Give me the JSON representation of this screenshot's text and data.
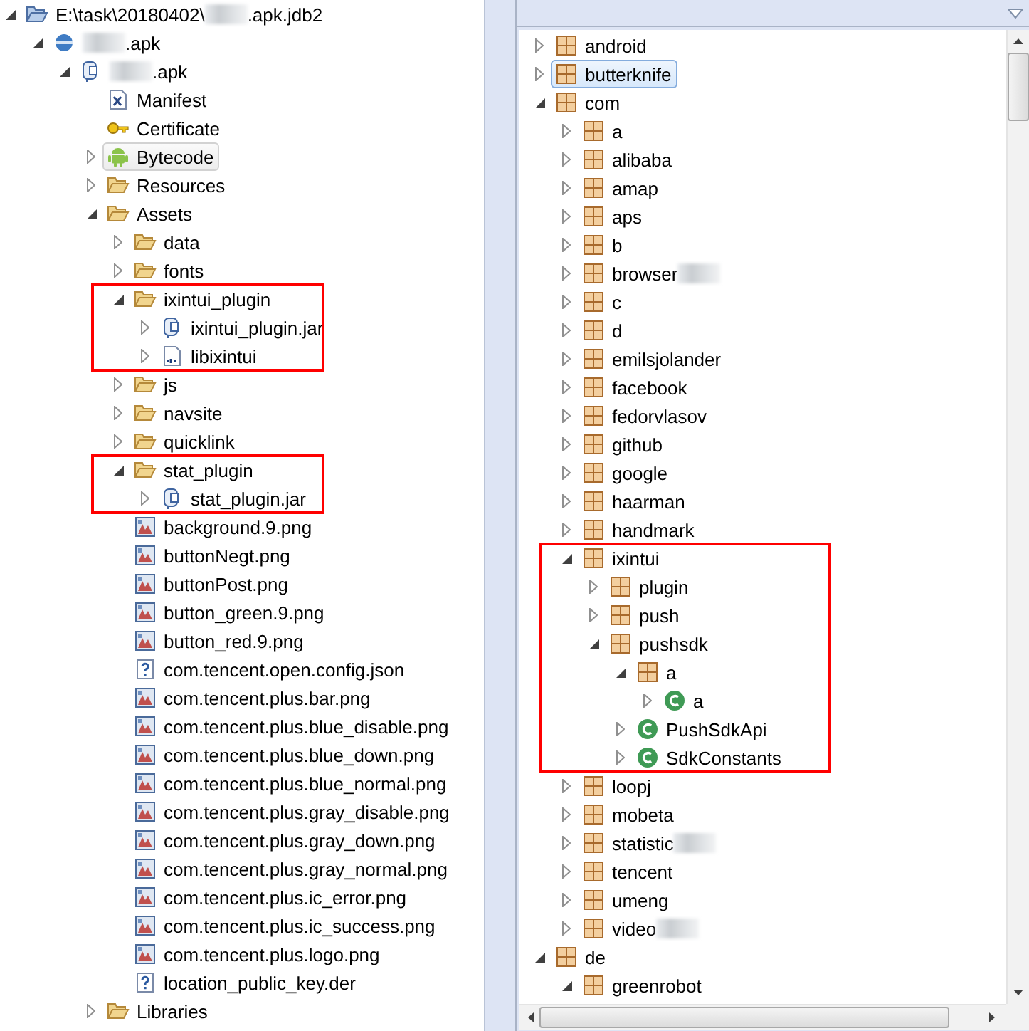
{
  "project_tree": [
    {
      "parts": [
        {
          "text": "E:\\task\\20180402\\"
        },
        {
          "kind": "blur"
        },
        {
          "text": ".apk.jdb2"
        }
      ],
      "kind": "project",
      "expanded": true,
      "selected": false,
      "children": [
        {
          "parts": [
            {
              "kind": "blur"
            },
            {
              "text": ".apk"
            }
          ],
          "kind": "sphere",
          "expanded": true,
          "selected": false,
          "children": [
            {
              "parts": [
                {
                  "kind": "blur"
                },
                {
                  "text": ".apk"
                }
              ],
              "kind": "archive",
              "expanded": true,
              "selected": false,
              "children": [
                {
                  "label": "Manifest",
                  "kind": "xml",
                  "selected": false
                },
                {
                  "label": "Certificate",
                  "kind": "key",
                  "selected": false
                },
                {
                  "label": "Bytecode",
                  "kind": "android",
                  "expanded": false,
                  "selected": true
                },
                {
                  "label": "Resources",
                  "kind": "folder",
                  "expanded": false,
                  "selected": false
                },
                {
                  "label": "Assets",
                  "kind": "folder",
                  "expanded": true,
                  "selected": false,
                  "children": [
                    {
                      "label": "data",
                      "kind": "folder",
                      "expanded": false,
                      "selected": false
                    },
                    {
                      "label": "fonts",
                      "kind": "folder",
                      "expanded": false,
                      "selected": false
                    },
                    {
                      "label": "ixintui_plugin",
                      "kind": "folder",
                      "expanded": true,
                      "selected": false,
                      "highlight": true,
                      "children": [
                        {
                          "label": "ixintui_plugin.jar",
                          "kind": "archive",
                          "expanded": false,
                          "selected": false
                        },
                        {
                          "label": "libixintui",
                          "kind": "binary",
                          "expanded": false,
                          "selected": false
                        }
                      ]
                    },
                    {
                      "label": "js",
                      "kind": "folder",
                      "expanded": false,
                      "selected": false
                    },
                    {
                      "label": "navsite",
                      "kind": "folder",
                      "expanded": false,
                      "selected": false
                    },
                    {
                      "label": "quicklink",
                      "kind": "folder",
                      "expanded": false,
                      "selected": false
                    },
                    {
                      "label": "stat_plugin",
                      "kind": "folder",
                      "expanded": true,
                      "selected": false,
                      "highlight": true,
                      "children": [
                        {
                          "label": "stat_plugin.jar",
                          "kind": "archive",
                          "expanded": false,
                          "selected": false
                        }
                      ]
                    },
                    {
                      "label": "background.9.png",
                      "kind": "image",
                      "selected": false
                    },
                    {
                      "label": "buttonNegt.png",
                      "kind": "image",
                      "selected": false
                    },
                    {
                      "label": "buttonPost.png",
                      "kind": "image",
                      "selected": false
                    },
                    {
                      "label": "button_green.9.png",
                      "kind": "image",
                      "selected": false
                    },
                    {
                      "label": "button_red.9.png",
                      "kind": "image",
                      "selected": false
                    },
                    {
                      "label": "com.tencent.open.config.json",
                      "kind": "unknown",
                      "selected": false
                    },
                    {
                      "label": "com.tencent.plus.bar.png",
                      "kind": "image",
                      "selected": false
                    },
                    {
                      "label": "com.tencent.plus.blue_disable.png",
                      "kind": "image",
                      "selected": false
                    },
                    {
                      "label": "com.tencent.plus.blue_down.png",
                      "kind": "image",
                      "selected": false
                    },
                    {
                      "label": "com.tencent.plus.blue_normal.png",
                      "kind": "image",
                      "selected": false
                    },
                    {
                      "label": "com.tencent.plus.gray_disable.png",
                      "kind": "image",
                      "selected": false
                    },
                    {
                      "label": "com.tencent.plus.gray_down.png",
                      "kind": "image",
                      "selected": false
                    },
                    {
                      "label": "com.tencent.plus.gray_normal.png",
                      "kind": "image",
                      "selected": false
                    },
                    {
                      "label": "com.tencent.plus.ic_error.png",
                      "kind": "image",
                      "selected": false
                    },
                    {
                      "label": "com.tencent.plus.ic_success.png",
                      "kind": "image",
                      "selected": false
                    },
                    {
                      "label": "com.tencent.plus.logo.png",
                      "kind": "image",
                      "selected": false
                    },
                    {
                      "label": "location_public_key.der",
                      "kind": "unknown",
                      "selected": false
                    }
                  ]
                },
                {
                  "label": "Libraries",
                  "kind": "folder",
                  "expanded": false,
                  "selected": false
                }
              ]
            }
          ]
        }
      ]
    }
  ],
  "package_tree": [
    {
      "label": "android",
      "kind": "package",
      "expanded": false,
      "selected": false
    },
    {
      "label": "butterknife",
      "kind": "package",
      "expanded": false,
      "selected": true
    },
    {
      "label": "com",
      "kind": "package",
      "expanded": true,
      "selected": false,
      "children": [
        {
          "label": "a",
          "kind": "package",
          "expanded": false,
          "selected": false
        },
        {
          "label": "alibaba",
          "kind": "package",
          "expanded": false,
          "selected": false
        },
        {
          "label": "amap",
          "kind": "package",
          "expanded": false,
          "selected": false
        },
        {
          "label": "aps",
          "kind": "package",
          "expanded": false,
          "selected": false
        },
        {
          "label": "b",
          "kind": "package",
          "expanded": false,
          "selected": false
        },
        {
          "parts": [
            {
              "text": "browser"
            },
            {
              "kind": "blur"
            }
          ],
          "kind": "package",
          "expanded": false,
          "selected": false
        },
        {
          "label": "c",
          "kind": "package",
          "expanded": false,
          "selected": false
        },
        {
          "label": "d",
          "kind": "package",
          "expanded": false,
          "selected": false
        },
        {
          "label": "emilsjolander",
          "kind": "package",
          "expanded": false,
          "selected": false
        },
        {
          "label": "facebook",
          "kind": "package",
          "expanded": false,
          "selected": false
        },
        {
          "label": "fedorvlasov",
          "kind": "package",
          "expanded": false,
          "selected": false
        },
        {
          "label": "github",
          "kind": "package",
          "expanded": false,
          "selected": false
        },
        {
          "label": "google",
          "kind": "package",
          "expanded": false,
          "selected": false
        },
        {
          "label": "haarman",
          "kind": "package",
          "expanded": false,
          "selected": false
        },
        {
          "label": "handmark",
          "kind": "package",
          "expanded": false,
          "selected": false
        },
        {
          "label": "ixintui",
          "kind": "package",
          "expanded": true,
          "selected": false,
          "highlight": true,
          "children": [
            {
              "label": "plugin",
              "kind": "package",
              "expanded": false,
              "selected": false
            },
            {
              "label": "push",
              "kind": "package",
              "expanded": false,
              "selected": false
            },
            {
              "label": "pushsdk",
              "kind": "package",
              "expanded": true,
              "selected": false,
              "children": [
                {
                  "label": "a",
                  "kind": "package",
                  "expanded": true,
                  "selected": false,
                  "children": [
                    {
                      "label": "a",
                      "kind": "class",
                      "expanded": false,
                      "selected": false
                    }
                  ]
                },
                {
                  "label": "PushSdkApi",
                  "kind": "class",
                  "expanded": false,
                  "selected": false
                },
                {
                  "label": "SdkConstants",
                  "kind": "class",
                  "expanded": false,
                  "selected": false
                }
              ]
            }
          ]
        },
        {
          "label": "loopj",
          "kind": "package",
          "expanded": false,
          "selected": false
        },
        {
          "label": "mobeta",
          "kind": "package",
          "expanded": false,
          "selected": false
        },
        {
          "parts": [
            {
              "text": "statistic"
            },
            {
              "kind": "blur"
            }
          ],
          "kind": "package",
          "expanded": false,
          "selected": false
        },
        {
          "label": "tencent",
          "kind": "package",
          "expanded": false,
          "selected": false
        },
        {
          "label": "umeng",
          "kind": "package",
          "expanded": false,
          "selected": false
        },
        {
          "parts": [
            {
              "text": "video"
            },
            {
              "kind": "blur"
            }
          ],
          "kind": "package",
          "expanded": false,
          "selected": false
        }
      ]
    },
    {
      "label": "de",
      "kind": "package",
      "expanded": true,
      "selected": false,
      "children": [
        {
          "label": "greenrobot",
          "kind": "package",
          "expanded": true,
          "selected": false
        }
      ]
    }
  ]
}
